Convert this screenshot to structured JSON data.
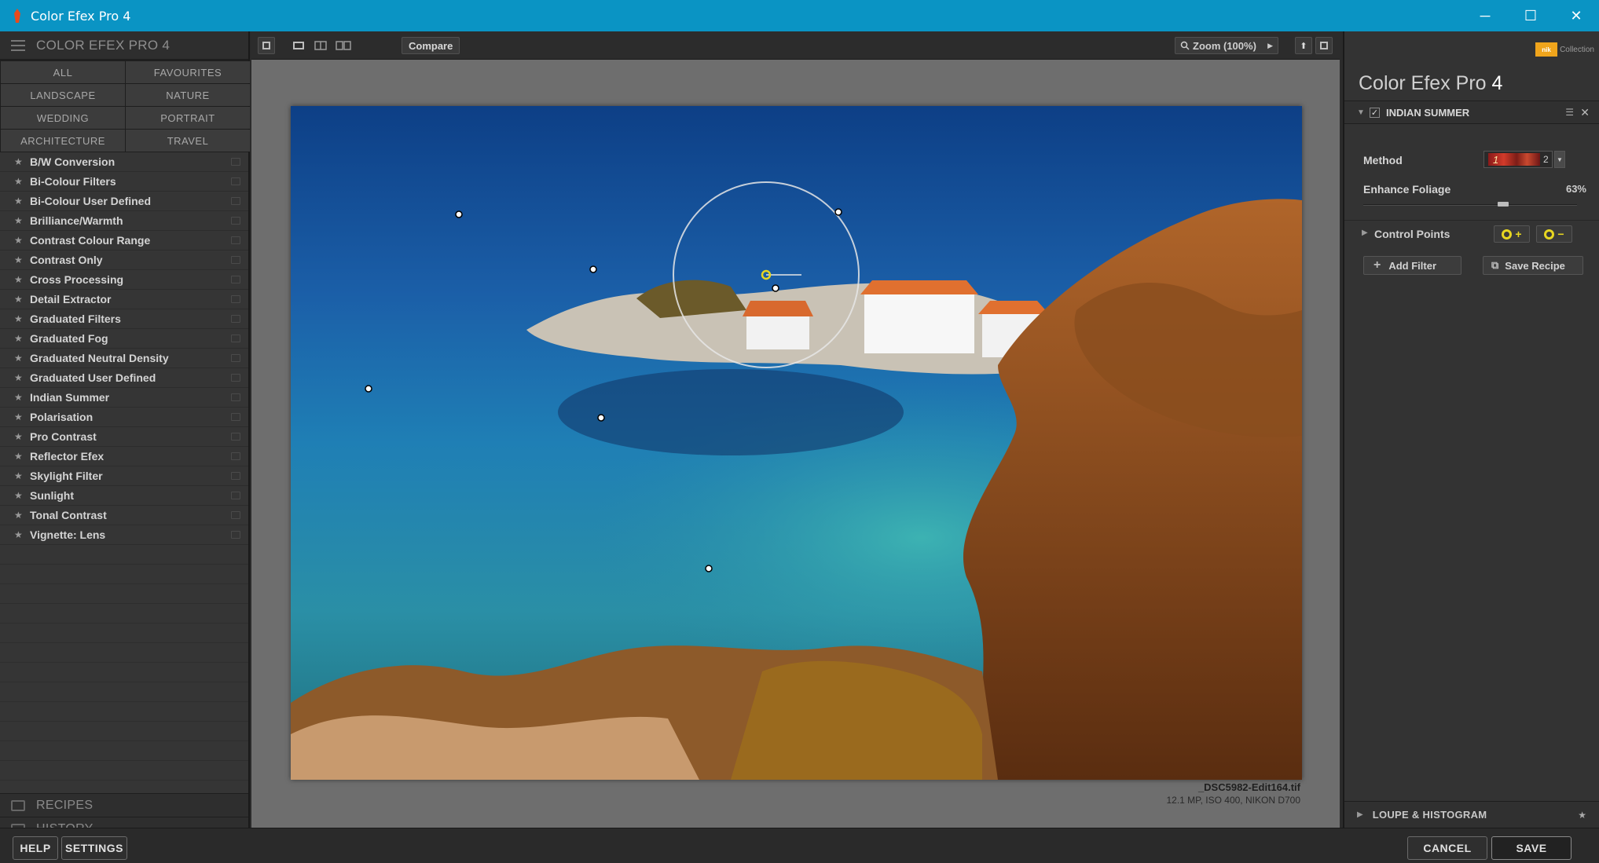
{
  "window": {
    "title": "Color Efex Pro 4",
    "controls": {
      "minimize": "─",
      "maximize": "☐",
      "close": "✕"
    }
  },
  "left_panel": {
    "header_title": "COLOR EFEX PRO 4",
    "categories": [
      "ALL",
      "FAVOURITES",
      "LANDSCAPE",
      "NATURE",
      "WEDDING",
      "PORTRAIT",
      "ARCHITECTURE",
      "TRAVEL"
    ],
    "filters": [
      "B/W Conversion",
      "Bi-Colour Filters",
      "Bi-Colour User Defined",
      "Brilliance/Warmth",
      "Contrast Colour Range",
      "Contrast Only",
      "Cross Processing",
      "Detail Extractor",
      "Graduated Filters",
      "Graduated Fog",
      "Graduated Neutral Density",
      "Graduated User Defined",
      "Indian Summer",
      "Polarisation",
      "Pro Contrast",
      "Reflector Efex",
      "Skylight Filter",
      "Sunlight",
      "Tonal Contrast",
      "Vignette: Lens"
    ],
    "recipes_label": "RECIPES",
    "history_label": "HISTORY"
  },
  "toolbar": {
    "compare_label": "Compare",
    "zoom_label": "Zoom (100%)"
  },
  "image_info": {
    "file_name": "_DSC5982-Edit164.tif",
    "meta": "12.1 MP, ISO 400, NIKON D700"
  },
  "right_panel": {
    "brand_badge": "nik",
    "brand_text": "Collection",
    "app_title": "Color Efex Pro",
    "app_version": "4",
    "active_filter": "INDIAN SUMMER",
    "method_label": "Method",
    "method_swatch_text": "1",
    "method_value": "2",
    "enhance_foliage_label": "Enhance Foliage",
    "enhance_foliage_value": "63%",
    "enhance_foliage_fraction": 0.63,
    "control_points_label": "Control Points",
    "add_filter_label": "Add Filter",
    "save_recipe_label": "Save Recipe",
    "loupe_label": "LOUPE & HISTOGRAM"
  },
  "bottom": {
    "help_label": "HELP",
    "settings_label": "SETTINGS",
    "cancel_label": "CANCEL",
    "save_label": "SAVE"
  },
  "colors": {
    "titlebar": "#0a94c4",
    "control_point_accent": "#e7d621"
  }
}
